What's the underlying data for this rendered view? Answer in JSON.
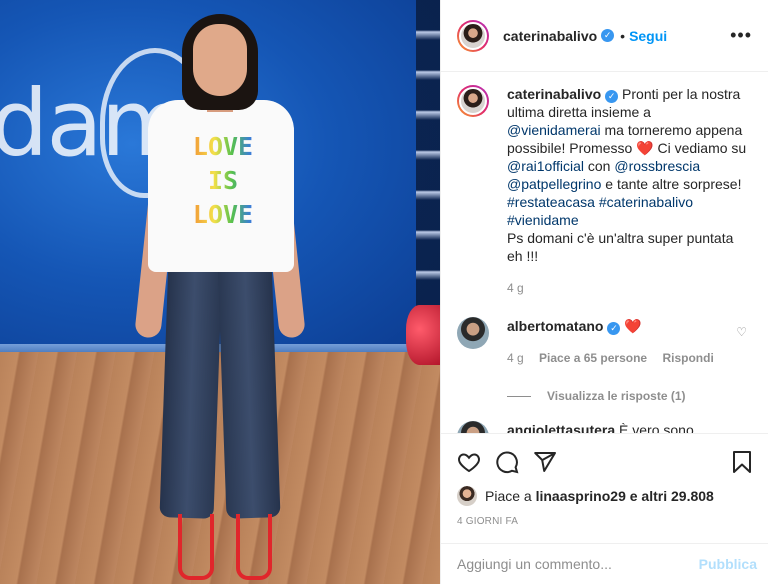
{
  "post": {
    "image_alt": "Photo by Caterina Balivo"
  },
  "header": {
    "username": "caterinabalivo",
    "verified_badge": "✓",
    "dot": "•",
    "follow_label": "Segui",
    "more_icon": "•••"
  },
  "caption": {
    "username": "caterinabalivo",
    "text_1": "Pronti per la nostra ultima diretta insieme a",
    "mention_1": "@vienidamerai",
    "text_2": "ma torneremo appena possibile! Promesso",
    "heart": "❤️",
    "text_3": "Ci vediamo su",
    "mention_2": "@rai1official",
    "text_4": "con",
    "mention_3": "@rossbrescia",
    "mention_4": "@patpellegrino",
    "text_5": "e tante altre sorprese!",
    "hashtag_1": "#restateacasa",
    "hashtag_2": "#caterinabalivo",
    "hashtag_3": "#vienidame",
    "text_6": "Ps domani c'è un'altra super puntata eh !!!",
    "time": "4 g"
  },
  "comments": [
    {
      "username": "albertomatano",
      "text": "❤️",
      "time": "4 g",
      "likes": "Piace a 65 persone",
      "reply_label": "Rispondi",
      "view_replies": "Visualizza le risposte (1)"
    },
    {
      "username": "angiolettasutera",
      "text": "È vero sono"
    }
  ],
  "actions": {
    "liked_by_prefix": "Piace a",
    "liked_by_user": "linaasprino29",
    "liked_by_suffix": "e altri 29.808",
    "posted_ago": "4 giorni fa"
  },
  "add_comment": {
    "placeholder": "Aggiungi un commento...",
    "publish_label": "Pubblica"
  },
  "shirt_print": [
    "LOVE",
    "IS",
    "LOVE"
  ],
  "backdrop_logo_text": "dam",
  "colors": {
    "link": "#00376b",
    "follow": "#0095f6",
    "heart": "#ed4956",
    "publish_disabled": "#b2dffc"
  }
}
